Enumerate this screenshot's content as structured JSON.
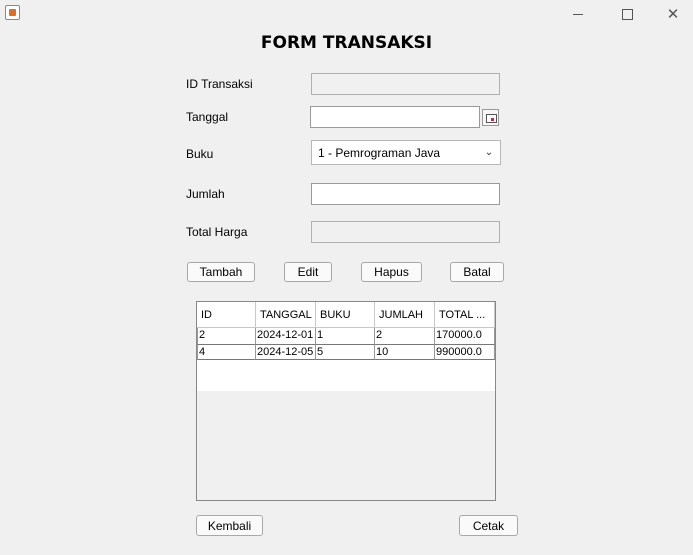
{
  "window": {
    "icon": "java-app-icon"
  },
  "form": {
    "title": "FORM TRANSAKSI",
    "id_label": "ID Transaksi",
    "id_value": "",
    "tanggal_label": "Tanggal",
    "tanggal_value": "",
    "buku_label": "Buku",
    "buku_value": "1 - Pemrograman Java",
    "jumlah_label": "Jumlah",
    "jumlah_value": "",
    "total_label": "Total Harga",
    "total_value": ""
  },
  "actions": {
    "tambah": "Tambah",
    "edit": "Edit",
    "hapus": "Hapus",
    "batal": "Batal"
  },
  "table": {
    "columns": [
      "ID",
      "TANGGAL",
      "BUKU",
      "JUMLAH",
      "TOTAL ..."
    ],
    "rows": [
      [
        "2",
        "2024-12-01",
        "1",
        "2",
        "170000.0"
      ],
      [
        "4",
        "2024-12-05",
        "5",
        "10",
        "990000.0"
      ]
    ]
  },
  "footer": {
    "kembali": "Kembali",
    "cetak": "Cetak"
  }
}
